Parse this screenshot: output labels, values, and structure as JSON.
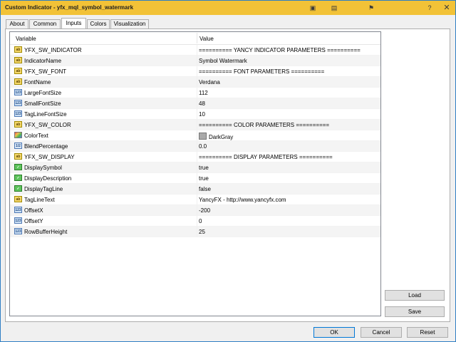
{
  "window": {
    "title": "Custom Indicator - yfx_mql_symbol_watermark",
    "accent": "#f2c237"
  },
  "titlebar_icons": [
    "info-icon",
    "chart-icon",
    "flag-icon",
    "help-icon",
    "close-icon"
  ],
  "tabs": [
    {
      "label": "About",
      "active": false
    },
    {
      "label": "Common",
      "active": false
    },
    {
      "label": "Inputs",
      "active": true
    },
    {
      "label": "Colors",
      "active": false
    },
    {
      "label": "Visualization",
      "active": false
    }
  ],
  "grid": {
    "headers": {
      "variable": "Variable",
      "value": "Value"
    },
    "rows": [
      {
        "icon": "ab",
        "name": "YFX_SW_INDICATOR",
        "value": "========== YANCY INDICATOR PARAMETERS =========="
      },
      {
        "icon": "ab",
        "name": "IndicatorName",
        "value": "Symbol Watermark"
      },
      {
        "icon": "ab",
        "name": "YFX_SW_FONT",
        "value": "========== FONT PARAMETERS =========="
      },
      {
        "icon": "ab",
        "name": "FontName",
        "value": "Verdana"
      },
      {
        "icon": "123",
        "name": "LargeFontSize",
        "value": "112"
      },
      {
        "icon": "123",
        "name": "SmallFontSize",
        "value": "48"
      },
      {
        "icon": "123",
        "name": "TagLineFontSize",
        "value": "10"
      },
      {
        "icon": "ab",
        "name": "YFX_SW_COLOR",
        "value": "========== COLOR PARAMETERS =========="
      },
      {
        "icon": "color",
        "name": "ColorText",
        "value": "DarkGray",
        "swatch": "#a9a9a9"
      },
      {
        "icon": "dbl",
        "name": "BlendPercentage",
        "value": "0.0"
      },
      {
        "icon": "ab",
        "name": "YFX_SW_DISPLAY",
        "value": "========== DISPLAY PARAMETERS =========="
      },
      {
        "icon": "bool",
        "name": "DisplaySymbol",
        "value": "true"
      },
      {
        "icon": "bool",
        "name": "DisplayDescription",
        "value": "true"
      },
      {
        "icon": "bool",
        "name": "DisplayTagLine",
        "value": "false"
      },
      {
        "icon": "ab",
        "name": "TagLineText",
        "value": "YancyFX - http://www.yancyfx.com"
      },
      {
        "icon": "123",
        "name": "OffsetX",
        "value": "-200"
      },
      {
        "icon": "123",
        "name": "OffsetY",
        "value": "0"
      },
      {
        "icon": "123",
        "name": "RowBufferHeight",
        "value": "25"
      }
    ]
  },
  "buttons": {
    "load": "Load",
    "save": "Save",
    "ok": "OK",
    "cancel": "Cancel",
    "reset": "Reset"
  }
}
